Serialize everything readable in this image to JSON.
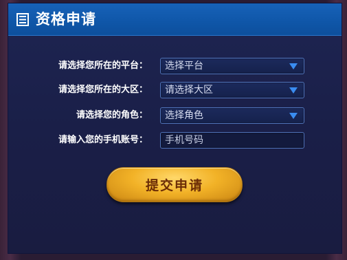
{
  "header": {
    "title": "资格申请",
    "icon": "document-list-icon"
  },
  "form": {
    "platform": {
      "label": "请选择您所在的平台：",
      "value": "选择平台"
    },
    "region": {
      "label": "请选择您所在的大区：",
      "value": "请选择大区"
    },
    "role": {
      "label": "请选择您的角色：",
      "value": "选择角色"
    },
    "phone": {
      "label": "请输入您的手机账号：",
      "placeholder": "手机号码"
    }
  },
  "submit": {
    "label": "提交申请"
  },
  "colors": {
    "header": "#0f56a8",
    "panel": "#1a1f48",
    "accent": "#3a8cf0",
    "button": "#f2b227"
  }
}
